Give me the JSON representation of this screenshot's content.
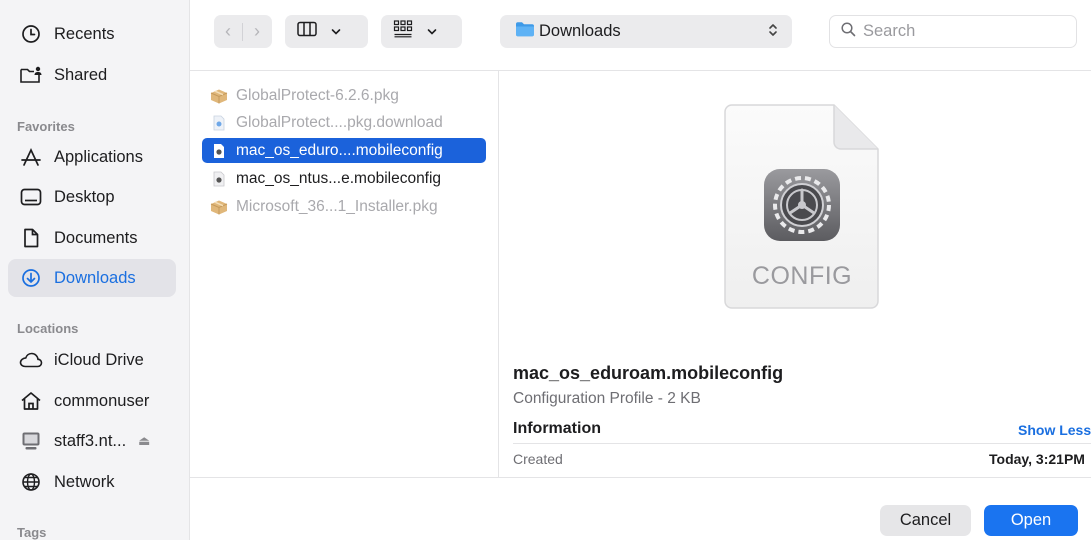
{
  "sidebar": {
    "recents": "Recents",
    "shared": "Shared",
    "favorites_header": "Favorites",
    "applications": "Applications",
    "desktop": "Desktop",
    "documents": "Documents",
    "downloads": "Downloads",
    "locations_header": "Locations",
    "icloud": "iCloud Drive",
    "home": "commonuser",
    "server": "staff3.nt...",
    "network": "Network",
    "tags_header": "Tags",
    "eject_glyph": "⏏"
  },
  "toolbar": {
    "back_glyph": "‹",
    "forward_glyph": "›",
    "location": "Downloads",
    "search_placeholder": "Search"
  },
  "files": [
    {
      "name": "GlobalProtect-6.2.6.pkg",
      "icon": "package-icon",
      "dimmed": true
    },
    {
      "name": "GlobalProtect....pkg.download",
      "icon": "download-file-icon",
      "dimmed": true
    },
    {
      "name": "mac_os_eduro....mobileconfig",
      "icon": "config-file-icon",
      "selected": true
    },
    {
      "name": "mac_os_ntus...e.mobileconfig",
      "icon": "config-file-icon"
    },
    {
      "name": "Microsoft_36...1_Installer.pkg",
      "icon": "package-icon",
      "dimmed": true
    }
  ],
  "preview": {
    "icon_label": "CONFIG",
    "name": "mac_os_eduroam.mobileconfig",
    "kind": "Configuration Profile - 2 KB",
    "info_header": "Information",
    "show_less": "Show Less",
    "created_label": "Created",
    "created_value": "Today, 3:21PM"
  },
  "buttons": {
    "cancel": "Cancel",
    "open": "Open"
  },
  "colors": {
    "accent": "#1a6fe0",
    "selection": "#1b62db",
    "open_button": "#1a74f0"
  }
}
